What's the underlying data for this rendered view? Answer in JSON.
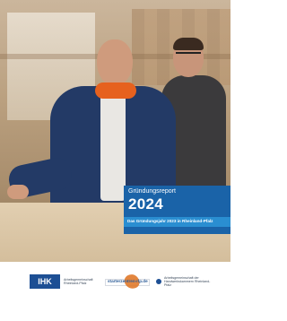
{
  "cover": {
    "report_label": "Gründungsreport",
    "year": "2024",
    "subtitle": "Das Gründungsjahr 2023 in Rheinland-Pfalz"
  },
  "logos": {
    "ihk": {
      "mark": "IHK",
      "text": "Arbeitsgemeinschaft Rheinland-Pfalz"
    },
    "starter": {
      "text": "starterzentren-rlp.de"
    },
    "hwk": {
      "text": "Arbeitsgemeinschaft der Handwerkskammern Rheinland-Pfalz"
    }
  },
  "colors": {
    "title_box": "#1a63a8",
    "subtitle_box": "#2a8ed1",
    "ihk_blue": "#1d4f94",
    "accent_orange": "#e0792a"
  }
}
